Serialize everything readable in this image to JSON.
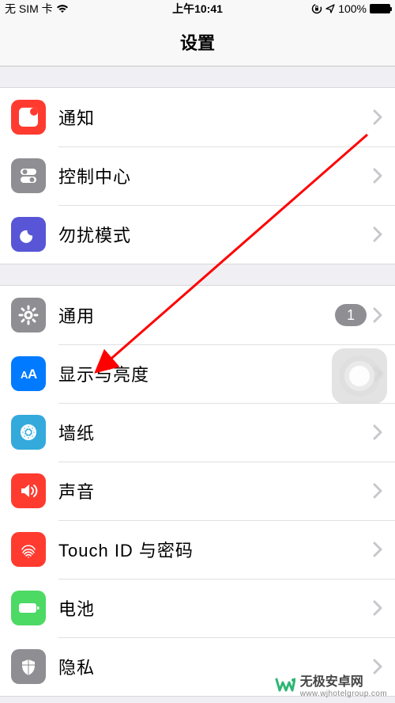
{
  "status": {
    "carrier": "无 SIM 卡",
    "time": "上午10:41",
    "battery_pct": "100%"
  },
  "header": {
    "title": "设置"
  },
  "group1": {
    "notifications": "通知",
    "control_center": "控制中心",
    "dnd": "勿扰模式"
  },
  "group2": {
    "general": "通用",
    "general_badge": "1",
    "display": "显示与亮度",
    "wallpaper": "墙纸",
    "sounds": "声音",
    "touchid": "Touch ID 与密码",
    "battery": "电池",
    "privacy": "隐私"
  },
  "watermark": {
    "brand": "无极安卓网",
    "url": "www.wjhotelgroup.com"
  }
}
